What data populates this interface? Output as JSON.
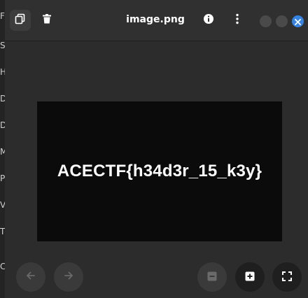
{
  "window": {
    "title": "image.png"
  },
  "header": {
    "copy_icon": "copy-icon",
    "delete_icon": "trash-icon",
    "properties_icon": "info-icon",
    "menu_icon": "kebab-menu-icon",
    "window_controls": [
      "minimize",
      "maximize",
      "close"
    ]
  },
  "image": {
    "text": "ACECTF{h34d3r_15_k3y}"
  },
  "background_window": {
    "letters": [
      "F",
      "S",
      "H",
      "D",
      "D",
      "M",
      "P",
      "V",
      "T",
      "C"
    ]
  },
  "toolbar": {
    "icons": [
      "arrow-left-icon",
      "arrow-right-icon",
      "zoom-out-icon",
      "zoom-in-icon",
      "fullscreen-icon"
    ]
  },
  "colors": {
    "accent": "#3584e4",
    "header_bg": "#303030",
    "viewer_bg": "#2c2c2c",
    "image_bg": "#0b0b0b"
  }
}
